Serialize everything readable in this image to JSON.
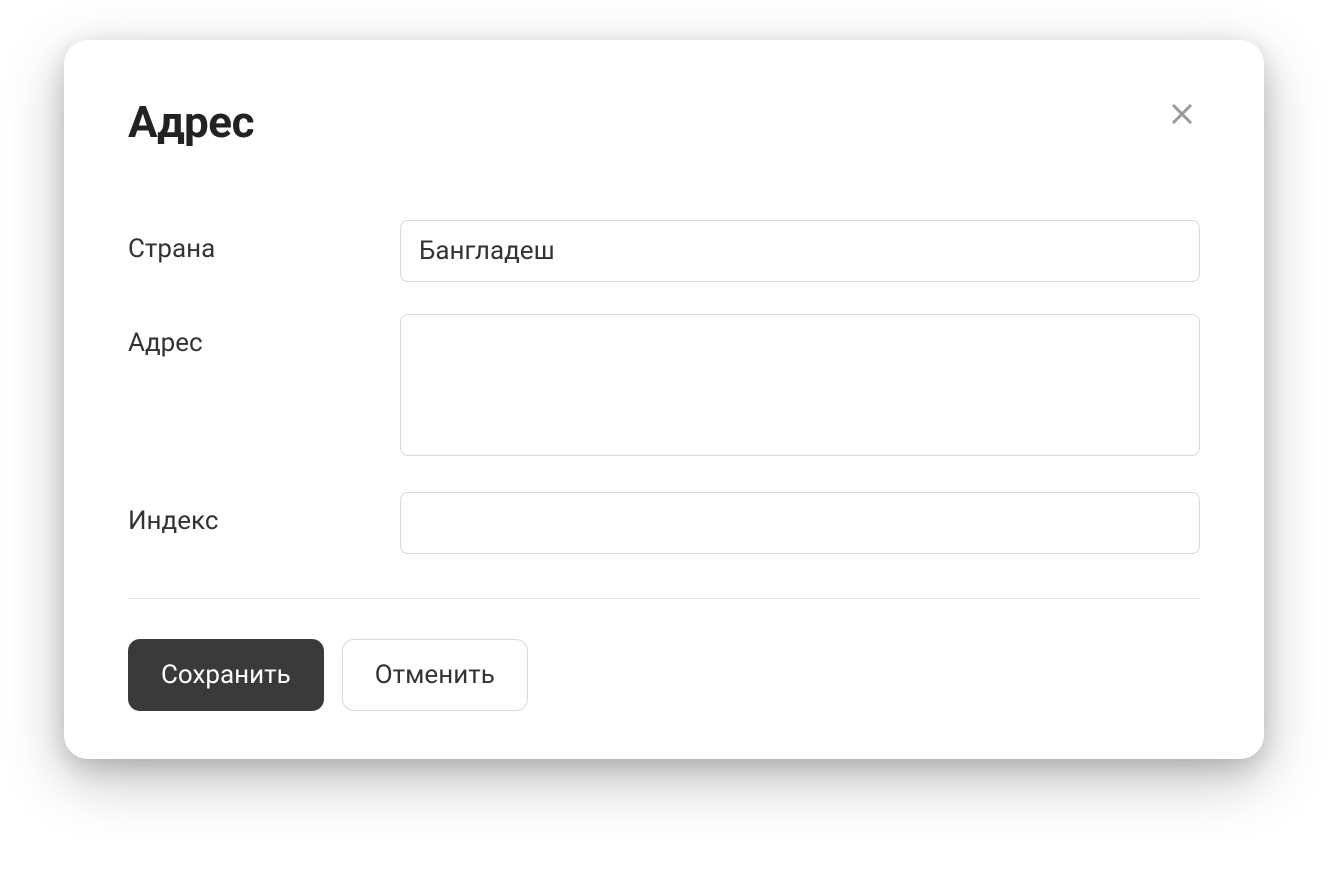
{
  "modal": {
    "title": "Адрес",
    "fields": {
      "country": {
        "label": "Страна",
        "value": "Бангладеш"
      },
      "address": {
        "label": "Адрес",
        "value": ""
      },
      "postal_code": {
        "label": "Индекс",
        "value": ""
      }
    },
    "actions": {
      "save_label": "Сохранить",
      "cancel_label": "Отменить"
    }
  }
}
